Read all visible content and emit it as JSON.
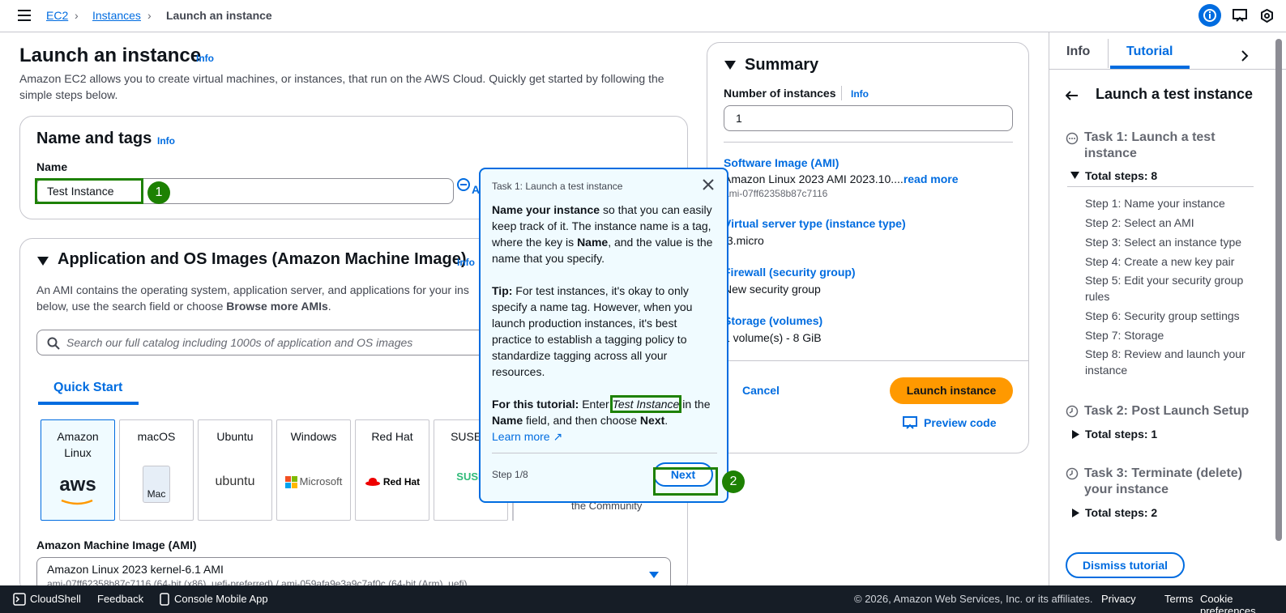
{
  "breadcrumb": {
    "ec2": "EC2",
    "instances": "Instances",
    "current": "Launch an instance"
  },
  "page": {
    "title": "Launch an instance",
    "info": "Info",
    "description": "Amazon EC2 allows you to create virtual machines, or instances, that run on the AWS Cloud. Quickly get started by following the simple steps below."
  },
  "name_tags": {
    "title": "Name and tags",
    "info": "Info",
    "name_label": "Name",
    "name_value": "Test Instance",
    "add_tags_icon_label": "A"
  },
  "ami_section": {
    "title": "Application and OS Images (Amazon Machine Image)",
    "info": "Info",
    "desc_1": "An AMI contains the operating system, application server, and applications for your ins",
    "desc_2a": "below, use the search field or choose ",
    "desc_2b": "Browse more AMIs",
    "desc_2c": ".",
    "search_placeholder": "Search our full catalog including 1000s of application and OS images",
    "tab": "Quick Start",
    "tiles": [
      "Amazon Linux",
      "macOS",
      "Ubuntu",
      "Windows",
      "Red Hat",
      "SUSE L"
    ],
    "logos": {
      "aws": "aws",
      "mac": "Mac",
      "ubuntu": "ubuntu",
      "microsoft": "Microsoft",
      "redhat": "Red Hat",
      "suse": "SUSE"
    },
    "community_text": "the Community",
    "ami_label": "Amazon Machine Image (AMI)",
    "ami_value": "Amazon Linux 2023 kernel-6.1 AMI",
    "ami_sub": "ami-07ff62358b87c7116 (64-bit (x86), uefi-preferred) / ami-059afa9e3a9c7af0c (64-bit (Arm), uefi)"
  },
  "summary": {
    "title": "Summary",
    "instances_label": "Number of instances",
    "info": "Info",
    "instances_value": "1",
    "ami_label": "Software Image (AMI)",
    "ami_value": "Amazon Linux 2023 AMI 2023.10....",
    "read_more": "read more",
    "ami_id": "ami-07ff62358b87c7116",
    "type_label": "Virtual server type (instance type)",
    "type_value": "t3.micro",
    "firewall_label": "Firewall (security group)",
    "firewall_value": "New security group",
    "storage_label": "Storage (volumes)",
    "storage_value": "1 volume(s) - 8 GiB",
    "cancel": "Cancel",
    "launch": "Launch instance",
    "preview": "Preview code"
  },
  "popover": {
    "header": "Task 1: Launch a test instance",
    "p1_b1": "Name your instance",
    "p1_t1": " so that you can easily keep track of it. The instance name is a tag, where the key is ",
    "p1_b2": "Name",
    "p1_t2": ", and the value is the name that you specify.",
    "p2_b": "Tip:",
    "p2_t": " For test instances, it's okay to only specify a name tag. However, when you launch production instances, it's best practice to establish a tagging policy to standardize tagging across all your resources.",
    "p3_b": "For this tutorial:",
    "p3_t1": " Enter ",
    "p3_i": "Test Instance",
    "p3_t2": " in the ",
    "p3_b2": "Name",
    "p3_t3": " field, and then choose ",
    "p3_b3": "Next",
    "p3_t4": ".",
    "learn_more": "Learn more",
    "step": "Step 1/8",
    "next": "Next"
  },
  "badges": [
    "1",
    "2"
  ],
  "tutorial": {
    "tab_info": "Info",
    "tab_tutorial": "Tutorial",
    "title": "Launch a test instance",
    "task1": "Task 1: Launch a test instance",
    "task1_steps": "Total steps: 8",
    "steps": [
      "Step 1: Name your instance",
      "Step 2: Select an AMI",
      "Step 3: Select an instance type",
      "Step 4: Create a new key pair",
      "Step 5: Edit your security group rules",
      "Step 6: Security group settings",
      "Step 7: Storage",
      "Step 8: Review and launch your instance"
    ],
    "task2": "Task 2: Post Launch Setup",
    "task2_steps": "Total steps: 1",
    "task3": "Task 3: Terminate (delete) your instance",
    "task3_steps": "Total steps: 2",
    "dismiss": "Dismiss tutorial"
  },
  "footer": {
    "cloudshell": "CloudShell",
    "feedback": "Feedback",
    "mobile": "Console Mobile App",
    "copyright": "© 2026, Amazon Web Services, Inc. or its affiliates.",
    "privacy": "Privacy",
    "terms": "Terms",
    "cookies": "Cookie preferences"
  }
}
